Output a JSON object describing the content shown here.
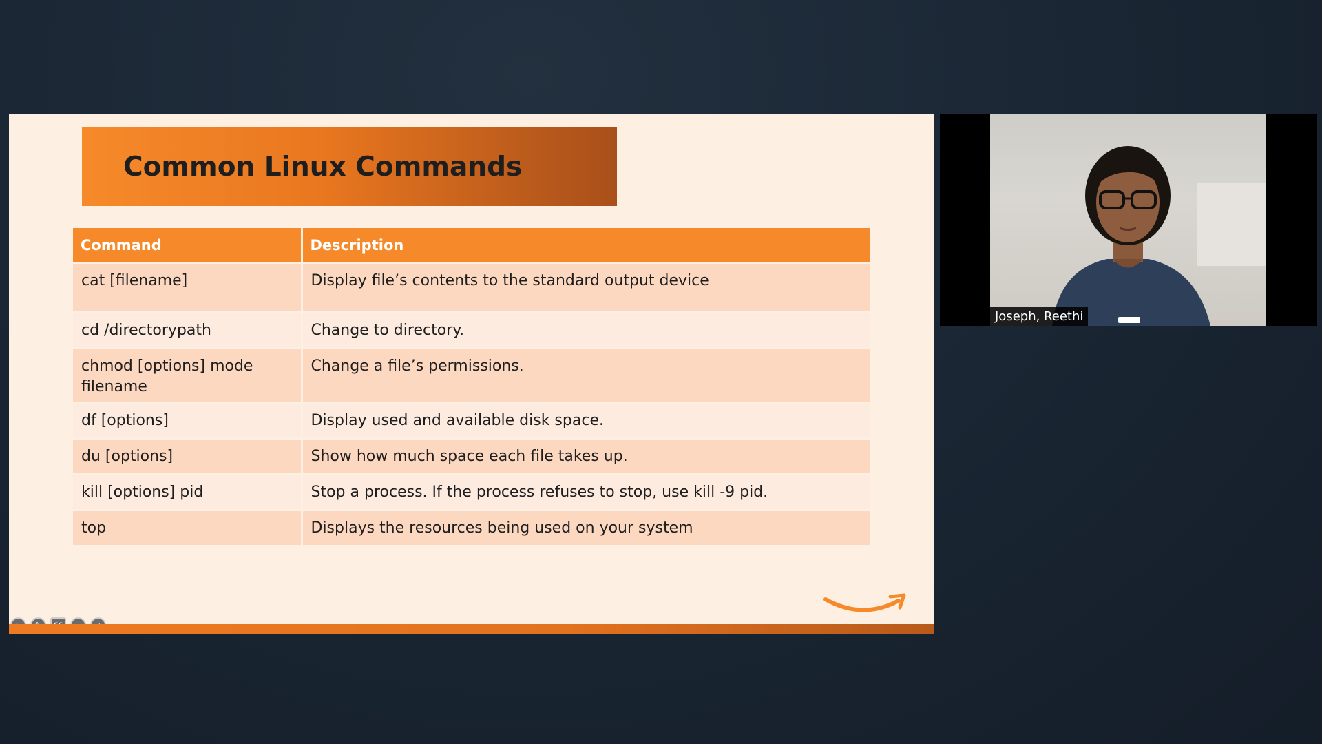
{
  "slide": {
    "title": "Common Linux Commands",
    "table": {
      "headers": [
        "Command",
        "Description"
      ],
      "rows": [
        {
          "command": "cat [filename]",
          "description": "Display file’s contents to the standard output device"
        },
        {
          "command": "cd /directorypath",
          "description": "Change to directory."
        },
        {
          "command": "chmod [options] mode filename",
          "description": "Change a file’s permissions."
        },
        {
          "command": "df [options]",
          "description": "Display used and available disk space."
        },
        {
          "command": "du [options]",
          "description": "Show how much space each file takes up."
        },
        {
          "command": "kill [options] pid",
          "description": "Stop a process. If the process refuses to stop, use kill -9 pid."
        },
        {
          "command": "top",
          "description": "Displays the resources being used on your system"
        }
      ]
    },
    "controls": [
      {
        "name": "previous-slide-button",
        "icon": "arrow-left-icon",
        "glyph": "←"
      },
      {
        "name": "pen-tool-button",
        "icon": "pencil-icon",
        "glyph": "✎"
      },
      {
        "name": "captions-button",
        "icon": "cc-icon",
        "glyph": "CC"
      },
      {
        "name": "more-options-button",
        "icon": "ellipsis-icon",
        "glyph": "…"
      },
      {
        "name": "next-slide-button",
        "icon": "arrow-right-icon",
        "glyph": "→"
      }
    ],
    "colors": {
      "accent": "#f68a2a",
      "slide_background": "#fdf0e3",
      "row_odd": "#fdd8c1",
      "row_even": "#fdebe0"
    }
  },
  "video": {
    "participant_name": "Joseph, Reethi",
    "mic_icon": "mic-status-icon"
  }
}
